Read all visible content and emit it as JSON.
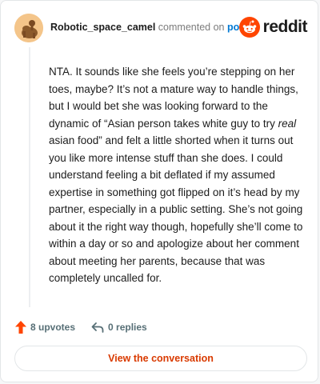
{
  "header": {
    "username": "Robotic_space_camel",
    "action_text": "commented on",
    "post_link": "post",
    "brand": "reddit"
  },
  "comment": {
    "part1": "NTA. It sounds like she feels you’re stepping on her toes, maybe? It’s not a mature way to handle things, but I would bet she was looking forward to the dynamic of “Asian person takes white guy to try ",
    "emphasis": "real",
    "part2": " asian food” and felt a little shorted when it turns out you like more intense stuff than she does. I could understand feeling a bit deflated if my assumed expertise in something got flipped on it’s head by my partner, especially in a public setting. She’s not going about it the right way though, hopefully she’ll come to within a day or so and apologize about her comment about meeting her parents, because that was completely uncalled for."
  },
  "actions": {
    "upvotes": "8 upvotes",
    "replies": "0 replies"
  },
  "footer": {
    "view_conversation": "View the conversation"
  },
  "colors": {
    "upvote": "#ff4500",
    "link": "#0079d3",
    "cta": "#d93a00"
  }
}
